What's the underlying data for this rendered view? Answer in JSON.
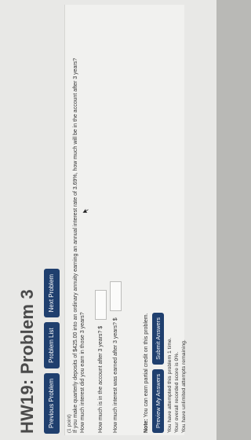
{
  "page": {
    "title": "HW19: Problem 3"
  },
  "nav": {
    "previous": "Previous Problem",
    "list": "Problem List",
    "next": "Next Problem"
  },
  "problem": {
    "points": "(1 point)",
    "question": "If you make quarterly deposits of $425.00 into an ordinary annuity earning an annual interest rate of 3.69%, how much will be in the account after 3 years?",
    "subquestion": "How much interest did you earn in those 3 years?",
    "part1_label": "How much is in the account after 3 years? $",
    "part1_value": "",
    "part2_label": "How much interest was earned after 3 years? $",
    "part2_value": ""
  },
  "note": {
    "label": "Note:",
    "text": "You can earn partial credit on this problem."
  },
  "actions": {
    "preview": "Preview My Answers",
    "submit": "Submit Answers"
  },
  "status": {
    "attempts": "You have attempted this problem 1 time.",
    "score": "Your overall recorded score is 0%.",
    "remaining": "You have unlimited attempts remaining."
  },
  "colors": {
    "button": "#1f3f6e",
    "background": "#e8e8e6"
  }
}
